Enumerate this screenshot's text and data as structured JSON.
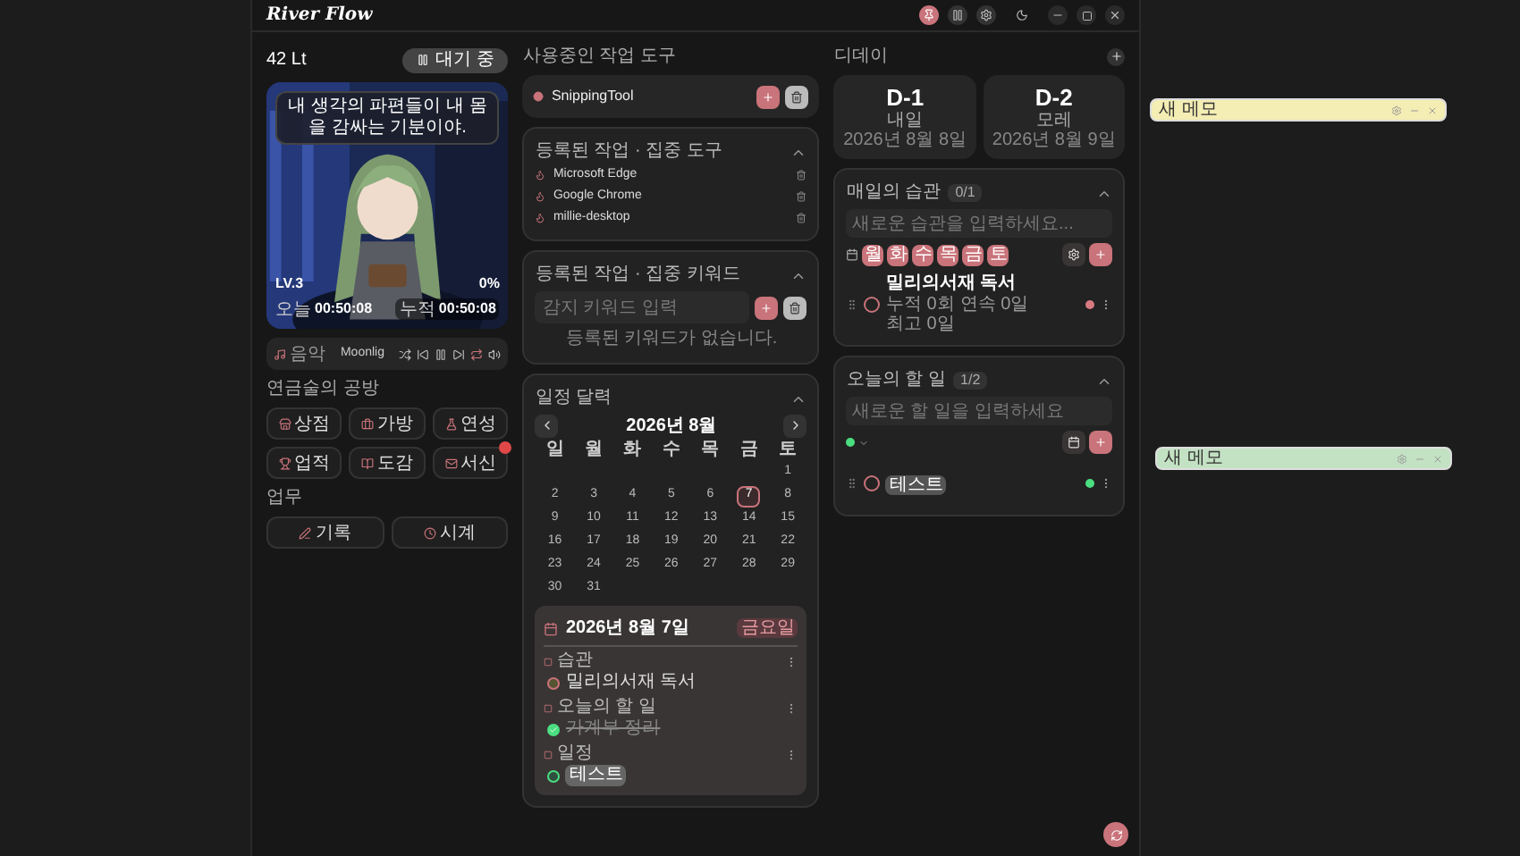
{
  "title": "River Flow",
  "status": {
    "count": "42 Lt",
    "button": "대기 중"
  },
  "character": {
    "speech": "내 생각의 파편들이 내 몸을 감싸는 기분이야.",
    "level": "LV.3",
    "percent": "0%",
    "today_label": "오늘",
    "today": "00:50:08",
    "total_label": "누적",
    "total": "00:50:08"
  },
  "music": {
    "label": "음악",
    "track": "Moonlig"
  },
  "workshop": {
    "title": "연금술의 공방",
    "buttons": [
      {
        "label": "상점",
        "badge": false
      },
      {
        "label": "가방",
        "badge": false
      },
      {
        "label": "연성",
        "badge": false
      },
      {
        "label": "업적",
        "badge": false
      },
      {
        "label": "도감",
        "badge": false
      },
      {
        "label": "서신",
        "badge": true
      }
    ]
  },
  "work": {
    "title": "업무",
    "buttons": [
      {
        "label": "기록"
      },
      {
        "label": "시계"
      }
    ]
  },
  "tools": {
    "title": "사용중인 작업 도구",
    "current": "SnippingTool",
    "registered": {
      "title": "등록된 작업 · 집중 도구",
      "expanded": true,
      "items": [
        "Microsoft Edge",
        "Google Chrome",
        "millie-desktop"
      ]
    },
    "keywords": {
      "title": "등록된 작업 · 집중 키워드",
      "expanded": true,
      "placeholder": "감지 키워드 입력",
      "empty": "등록된 키워드가 없습니다."
    }
  },
  "calendar": {
    "title": "일정 달력",
    "expanded": true,
    "month": "2026년 8월",
    "weekdays": [
      "일",
      "월",
      "화",
      "수",
      "목",
      "금",
      "토"
    ],
    "days": [
      {
        "label": "1",
        "selected": false
      },
      {
        "label": "2",
        "selected": false
      },
      {
        "label": "3",
        "selected": false
      },
      {
        "label": "4",
        "selected": false
      },
      {
        "label": "5",
        "selected": false
      },
      {
        "label": "6",
        "selected": false
      },
      {
        "label": "7",
        "selected": true
      },
      {
        "label": "8",
        "selected": false
      },
      {
        "label": "9",
        "selected": false
      },
      {
        "label": "10",
        "selected": false
      },
      {
        "label": "11",
        "selected": false
      },
      {
        "label": "12",
        "selected": false
      },
      {
        "label": "13",
        "selected": false
      },
      {
        "label": "14",
        "selected": false
      },
      {
        "label": "15",
        "selected": false
      },
      {
        "label": "16",
        "selected": false
      },
      {
        "label": "17",
        "selected": false
      },
      {
        "label": "18",
        "selected": false
      },
      {
        "label": "19",
        "selected": false
      },
      {
        "label": "20",
        "selected": false
      },
      {
        "label": "21",
        "selected": false
      },
      {
        "label": "22",
        "selected": false
      },
      {
        "label": "23",
        "selected": false
      },
      {
        "label": "24",
        "selected": false
      },
      {
        "label": "25",
        "selected": false
      },
      {
        "label": "26",
        "selected": false
      },
      {
        "label": "27",
        "selected": false
      },
      {
        "label": "28",
        "selected": false
      },
      {
        "label": "29",
        "selected": false
      },
      {
        "label": "30",
        "selected": false
      },
      {
        "label": "31",
        "selected": false
      }
    ],
    "detail": {
      "date": "2026년 8월 7일",
      "badge": "금요일",
      "sections": [
        {
          "title": "습관",
          "items": [
            {
              "text": "밀리의서재 독서",
              "kind": "habit",
              "done": false
            }
          ]
        },
        {
          "title": "오늘의 할 일",
          "items": [
            {
              "text": "가계부 정리",
              "kind": "todo",
              "done": true
            }
          ]
        },
        {
          "title": "일정",
          "items": [
            {
              "text": "테스트",
              "kind": "event",
              "done": false
            }
          ]
        }
      ]
    }
  },
  "dday": {
    "title": "디데이",
    "items": [
      {
        "label": "D-1",
        "name": "내일",
        "date": "2026년 8월 8일"
      },
      {
        "label": "D-2",
        "name": "모레",
        "date": "2026년 8월 9일"
      }
    ]
  },
  "habits": {
    "title": "매일의 습관",
    "count": "0/1",
    "expanded": true,
    "placeholder": "새로운 습관을 입력하세요...",
    "days": [
      {
        "label": "월",
        "selected": true
      },
      {
        "label": "화",
        "selected": true
      },
      {
        "label": "수",
        "selected": true
      },
      {
        "label": "목",
        "selected": true
      },
      {
        "label": "금",
        "selected": true
      },
      {
        "label": "토",
        "selected": true
      }
    ],
    "items": [
      {
        "name": "밀리의서재 독서",
        "stats": [
          "누적 0회",
          "연속 0일",
          "최고 0일"
        ],
        "done": false,
        "color": "#d87a82"
      }
    ]
  },
  "todos": {
    "title": "오늘의 할 일",
    "count": "1/2",
    "expanded": true,
    "placeholder": "새로운 할 일을 입력하세요",
    "items": [
      {
        "text": "테스트",
        "done": false,
        "color": "#4ade80"
      }
    ]
  },
  "notes": [
    {
      "title": "새 메모",
      "color": "#f4edb4"
    },
    {
      "title": "새 메모",
      "color": "#c3e2c3"
    }
  ]
}
